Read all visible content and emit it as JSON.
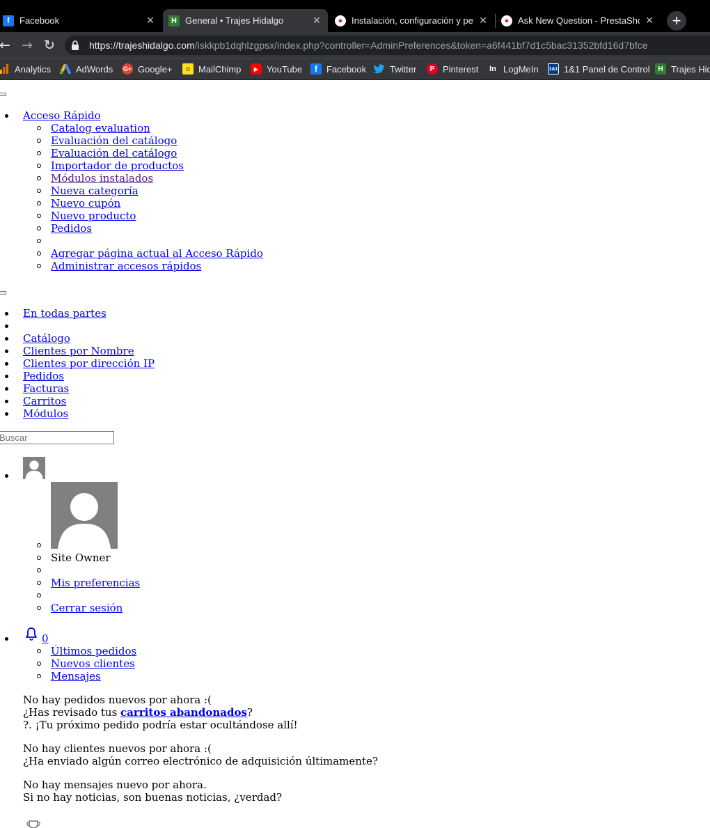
{
  "browser": {
    "tabs": [
      {
        "title": "Facebook",
        "favicon": "facebook-icon"
      },
      {
        "title": "General • Trajes Hidalgo",
        "favicon": "trajes-hidalgo-icon"
      },
      {
        "title": "Instalación, configuración y perso",
        "favicon": "prestashop-icon"
      },
      {
        "title": "Ask New Question - PrestaShop",
        "favicon": "prestashop-icon"
      }
    ],
    "new_tab": "+",
    "close_glyph": "✕",
    "url_host": "https://trajeshidalgo.com",
    "url_path": "/iskkpb1dqhlzgpsx/index.php?controller=AdminPreferences&token=a6f441bf7d1c5bac31352bfd16d7bfce",
    "bookmarks": [
      {
        "label": "Analytics",
        "icon": "analytics-icon"
      },
      {
        "label": "AdWords",
        "icon": "adwords-icon"
      },
      {
        "label": "Google+",
        "icon": "google-plus-icon"
      },
      {
        "label": "MailChimp",
        "icon": "mailchimp-icon"
      },
      {
        "label": "YouTube",
        "icon": "youtube-icon"
      },
      {
        "label": "Facebook",
        "icon": "facebook-icon"
      },
      {
        "label": "Twitter",
        "icon": "twitter-icon"
      },
      {
        "label": "Pinterest",
        "icon": "pinterest-icon"
      },
      {
        "label": "LogMeIn",
        "icon": "logmein-icon"
      },
      {
        "label": "1&1 Panel de Control",
        "icon": "ionos-icon"
      },
      {
        "label": "Trajes Hida",
        "icon": "trajes-hidalgo-icon"
      }
    ]
  },
  "quick_access": {
    "title": "Acceso Rápido",
    "items": [
      "Catalog evaluation",
      "Evaluación del catálogo",
      "Evaluación del catálogo",
      "Importador de productos",
      "Módulos instalados",
      "Nueva categoría",
      "Nuevo cupón",
      "Nuevo producto",
      "Pedidos"
    ],
    "add_current": "Agregar página actual al Acceso Rápido",
    "manage": "Administrar accesos rápidos"
  },
  "search_scope": {
    "everywhere": "En todas partes",
    "items": [
      "Catálogo",
      "Clientes por Nombre",
      "Clientes por dirección IP",
      "Pedidos",
      "Facturas",
      "Carritos",
      "Módulos"
    ]
  },
  "search": {
    "placeholder": "Buscar"
  },
  "employee": {
    "name": "Site Owner",
    "preferences": "Mis preferencias",
    "logout": "Cerrar sesión"
  },
  "notifications": {
    "count": "0",
    "tabs": [
      "Últimos pedidos",
      "Nuevos clientes",
      "Mensajes"
    ],
    "orders_empty": "No hay pedidos nuevos por ahora :(",
    "orders_hint_prefix": "¿Has revisado tus ",
    "orders_hint_link": "carritos abandonados",
    "orders_hint_suffix": "?",
    "orders_hint2": "?. ¡Tu próximo pedido podría estar ocultándose allí!",
    "customers_empty": "No hay clientes nuevos por ahora :(",
    "customers_hint": "¿Ha enviado algún correo electrónico de adquisición últimamente?",
    "messages_empty": "No hay mensajes nuevo por ahora.",
    "messages_hint": "Si no hay noticias, son buenas noticias, ¿verdad?"
  },
  "colors": {
    "link": "#0000ee",
    "visited": "#551a8b",
    "chrome_bg": "#202124",
    "toolbar_bg": "#35363a"
  }
}
